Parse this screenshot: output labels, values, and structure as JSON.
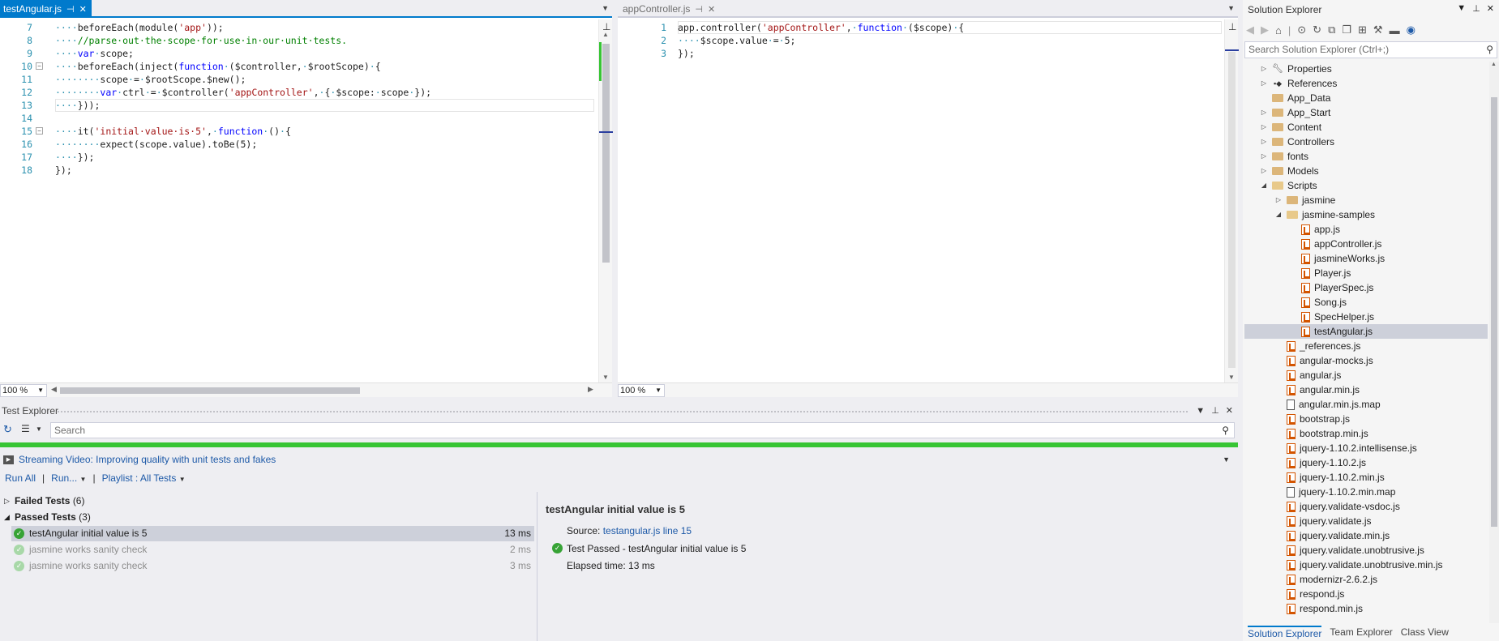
{
  "editor_left": {
    "tab_label": "testAngular.js",
    "zoom": "100 %",
    "lines": [
      {
        "num": "7",
        "tokens": [
          [
            "ws",
            "····"
          ],
          [
            "",
            "beforeEach(module("
          ],
          [
            "str",
            "'app'"
          ],
          [
            "",
            "));"
          ]
        ]
      },
      {
        "num": "8",
        "tokens": [
          [
            "ws",
            "····"
          ],
          [
            "cmt",
            "//parse·out·the·scope·for·use·in·our·unit·tests."
          ]
        ]
      },
      {
        "num": "9",
        "tokens": [
          [
            "ws",
            "····"
          ],
          [
            "kw",
            "var"
          ],
          [
            "ws",
            "·"
          ],
          [
            "",
            "scope;"
          ]
        ]
      },
      {
        "num": "10",
        "tokens": [
          [
            "ws",
            "····"
          ],
          [
            "",
            "beforeEach(inject("
          ],
          [
            "kw",
            "function"
          ],
          [
            "ws",
            "·"
          ],
          [
            "",
            "($controller,"
          ],
          [
            "ws",
            "·"
          ],
          [
            "",
            "$rootScope)"
          ],
          [
            "ws",
            "·"
          ],
          [
            "",
            "{"
          ]
        ]
      },
      {
        "num": "11",
        "tokens": [
          [
            "ws",
            "········"
          ],
          [
            "",
            "scope"
          ],
          [
            "ws",
            "·"
          ],
          [
            "",
            "="
          ],
          [
            "ws",
            "·"
          ],
          [
            "",
            "$rootScope.$new();"
          ]
        ]
      },
      {
        "num": "12",
        "tokens": [
          [
            "ws",
            "········"
          ],
          [
            "kw",
            "var"
          ],
          [
            "ws",
            "·"
          ],
          [
            "",
            "ctrl"
          ],
          [
            "ws",
            "·"
          ],
          [
            "",
            "="
          ],
          [
            "ws",
            "·"
          ],
          [
            "",
            "$controller("
          ],
          [
            "str",
            "'appController'"
          ],
          [
            "",
            ","
          ],
          [
            "ws",
            "·"
          ],
          [
            "",
            "{"
          ],
          [
            "ws",
            "·"
          ],
          [
            "",
            "$scope:"
          ],
          [
            "ws",
            "·"
          ],
          [
            "",
            "scope"
          ],
          [
            "ws",
            "·"
          ],
          [
            "",
            "});"
          ]
        ]
      },
      {
        "num": "13",
        "tokens": [
          [
            "ws",
            "····"
          ],
          [
            "",
            "}));"
          ]
        ]
      },
      {
        "num": "14",
        "tokens": []
      },
      {
        "num": "15",
        "tokens": [
          [
            "ws",
            "····"
          ],
          [
            "",
            "it("
          ],
          [
            "str",
            "'initial·value·is·5'"
          ],
          [
            "",
            ","
          ],
          [
            "ws",
            "·"
          ],
          [
            "kw",
            "function"
          ],
          [
            "ws",
            "·"
          ],
          [
            "",
            "()"
          ],
          [
            "ws",
            "·"
          ],
          [
            "",
            "{"
          ]
        ]
      },
      {
        "num": "16",
        "tokens": [
          [
            "ws",
            "········"
          ],
          [
            "",
            "expect(scope.value).toBe(5);"
          ]
        ]
      },
      {
        "num": "17",
        "tokens": [
          [
            "ws",
            "····"
          ],
          [
            "",
            "});"
          ]
        ]
      },
      {
        "num": "18",
        "tokens": [
          [
            "",
            "});"
          ]
        ]
      }
    ]
  },
  "editor_right": {
    "tab_label": "appController.js",
    "zoom": "100 %",
    "lines": [
      {
        "num": "1",
        "tokens": [
          [
            "",
            "app.controller("
          ],
          [
            "str",
            "'appController'"
          ],
          [
            "",
            ","
          ],
          [
            "ws",
            "·"
          ],
          [
            "kw",
            "function"
          ],
          [
            "ws",
            "·"
          ],
          [
            "",
            "($scope)"
          ],
          [
            "ws",
            "·"
          ],
          [
            "",
            "{"
          ]
        ]
      },
      {
        "num": "2",
        "tokens": [
          [
            "ws",
            "····"
          ],
          [
            "",
            "$scope.value"
          ],
          [
            "ws",
            "·"
          ],
          [
            "",
            "="
          ],
          [
            "ws",
            "·"
          ],
          [
            "",
            "5;"
          ]
        ]
      },
      {
        "num": "3",
        "tokens": [
          [
            "",
            "});"
          ]
        ]
      }
    ]
  },
  "test_explorer": {
    "title": "Test Explorer",
    "search_placeholder": "Search",
    "video_link": "Streaming Video: Improving quality with unit tests and fakes",
    "run_all": "Run All",
    "run": "Run...",
    "playlist": "Playlist : All Tests",
    "failed_group": {
      "label": "Failed Tests",
      "count": "(6)"
    },
    "passed_group": {
      "label": "Passed Tests",
      "count": "(3)"
    },
    "tests": [
      {
        "name": "testAngular  initial value is 5",
        "duration": "13 ms"
      },
      {
        "name": "jasmine works sanity check",
        "duration": "2 ms"
      },
      {
        "name": "jasmine works sanity check",
        "duration": "3 ms"
      }
    ],
    "detail": {
      "title": "testAngular  initial value is 5",
      "source_label": "Source:",
      "source_link": "testangular.js line 15",
      "result": "Test Passed - testAngular  initial value is 5",
      "elapsed": "Elapsed time: 13 ms"
    },
    "progress_color": "#37C534"
  },
  "solution_explorer": {
    "title": "Solution Explorer",
    "search_placeholder": "Search Solution Explorer (Ctrl+;)",
    "items": [
      {
        "label": "Properties",
        "icon": "wrench-icon",
        "arrow": "▷"
      },
      {
        "label": "References",
        "icon": "references-icon",
        "arrow": "▷"
      },
      {
        "label": "App_Data",
        "icon": "folder-icon",
        "arrow": ""
      },
      {
        "label": "App_Start",
        "icon": "folder-icon",
        "arrow": "▷"
      },
      {
        "label": "Content",
        "icon": "folder-icon",
        "arrow": "▷"
      },
      {
        "label": "Controllers",
        "icon": "folder-icon",
        "arrow": "▷"
      },
      {
        "label": "fonts",
        "icon": "folder-icon",
        "arrow": "▷"
      },
      {
        "label": "Models",
        "icon": "folder-icon",
        "arrow": "▷"
      },
      {
        "label": "Scripts",
        "icon": "folder-open-icon",
        "arrow": "◢"
      },
      {
        "label": "jasmine",
        "icon": "folder-icon",
        "arrow": "▷"
      },
      {
        "label": "jasmine-samples",
        "icon": "folder-open-icon",
        "arrow": "◢"
      },
      {
        "label": "app.js",
        "icon": "js-file-icon",
        "arrow": ""
      },
      {
        "label": "appController.js",
        "icon": "js-file-icon",
        "arrow": ""
      },
      {
        "label": "jasmineWorks.js",
        "icon": "js-file-icon",
        "arrow": ""
      },
      {
        "label": "Player.js",
        "icon": "js-file-icon",
        "arrow": ""
      },
      {
        "label": "PlayerSpec.js",
        "icon": "js-file-icon",
        "arrow": ""
      },
      {
        "label": "Song.js",
        "icon": "js-file-icon",
        "arrow": ""
      },
      {
        "label": "SpecHelper.js",
        "icon": "js-file-icon",
        "arrow": ""
      },
      {
        "label": "testAngular.js",
        "icon": "js-file-icon",
        "arrow": ""
      },
      {
        "label": "_references.js",
        "icon": "js-file-icon",
        "arrow": ""
      },
      {
        "label": "angular-mocks.js",
        "icon": "js-file-icon",
        "arrow": ""
      },
      {
        "label": "angular.js",
        "icon": "js-file-icon",
        "arrow": ""
      },
      {
        "label": "angular.min.js",
        "icon": "js-file-icon",
        "arrow": ""
      },
      {
        "label": "angular.min.js.map",
        "icon": "file-icon",
        "arrow": ""
      },
      {
        "label": "bootstrap.js",
        "icon": "js-file-icon",
        "arrow": ""
      },
      {
        "label": "bootstrap.min.js",
        "icon": "js-file-icon",
        "arrow": ""
      },
      {
        "label": "jquery-1.10.2.intellisense.js",
        "icon": "js-file-icon",
        "arrow": ""
      },
      {
        "label": "jquery-1.10.2.js",
        "icon": "js-file-icon",
        "arrow": ""
      },
      {
        "label": "jquery-1.10.2.min.js",
        "icon": "js-file-icon",
        "arrow": ""
      },
      {
        "label": "jquery-1.10.2.min.map",
        "icon": "file-icon",
        "arrow": ""
      },
      {
        "label": "jquery.validate-vsdoc.js",
        "icon": "js-file-icon",
        "arrow": ""
      },
      {
        "label": "jquery.validate.js",
        "icon": "js-file-icon",
        "arrow": ""
      },
      {
        "label": "jquery.validate.min.js",
        "icon": "js-file-icon",
        "arrow": ""
      },
      {
        "label": "jquery.validate.unobtrusive.js",
        "icon": "js-file-icon",
        "arrow": ""
      },
      {
        "label": "jquery.validate.unobtrusive.min.js",
        "icon": "js-file-icon",
        "arrow": ""
      },
      {
        "label": "modernizr-2.6.2.js",
        "icon": "js-file-icon",
        "arrow": ""
      },
      {
        "label": "respond.js",
        "icon": "js-file-icon",
        "arrow": ""
      },
      {
        "label": "respond.min.js",
        "icon": "js-file-icon",
        "arrow": ""
      }
    ],
    "bottom_tabs": [
      "Solution Explorer",
      "Team Explorer",
      "Class View"
    ]
  },
  "colors": {
    "accent": "#007ACC",
    "link": "#1E5AA8",
    "pass": "#37A336"
  }
}
